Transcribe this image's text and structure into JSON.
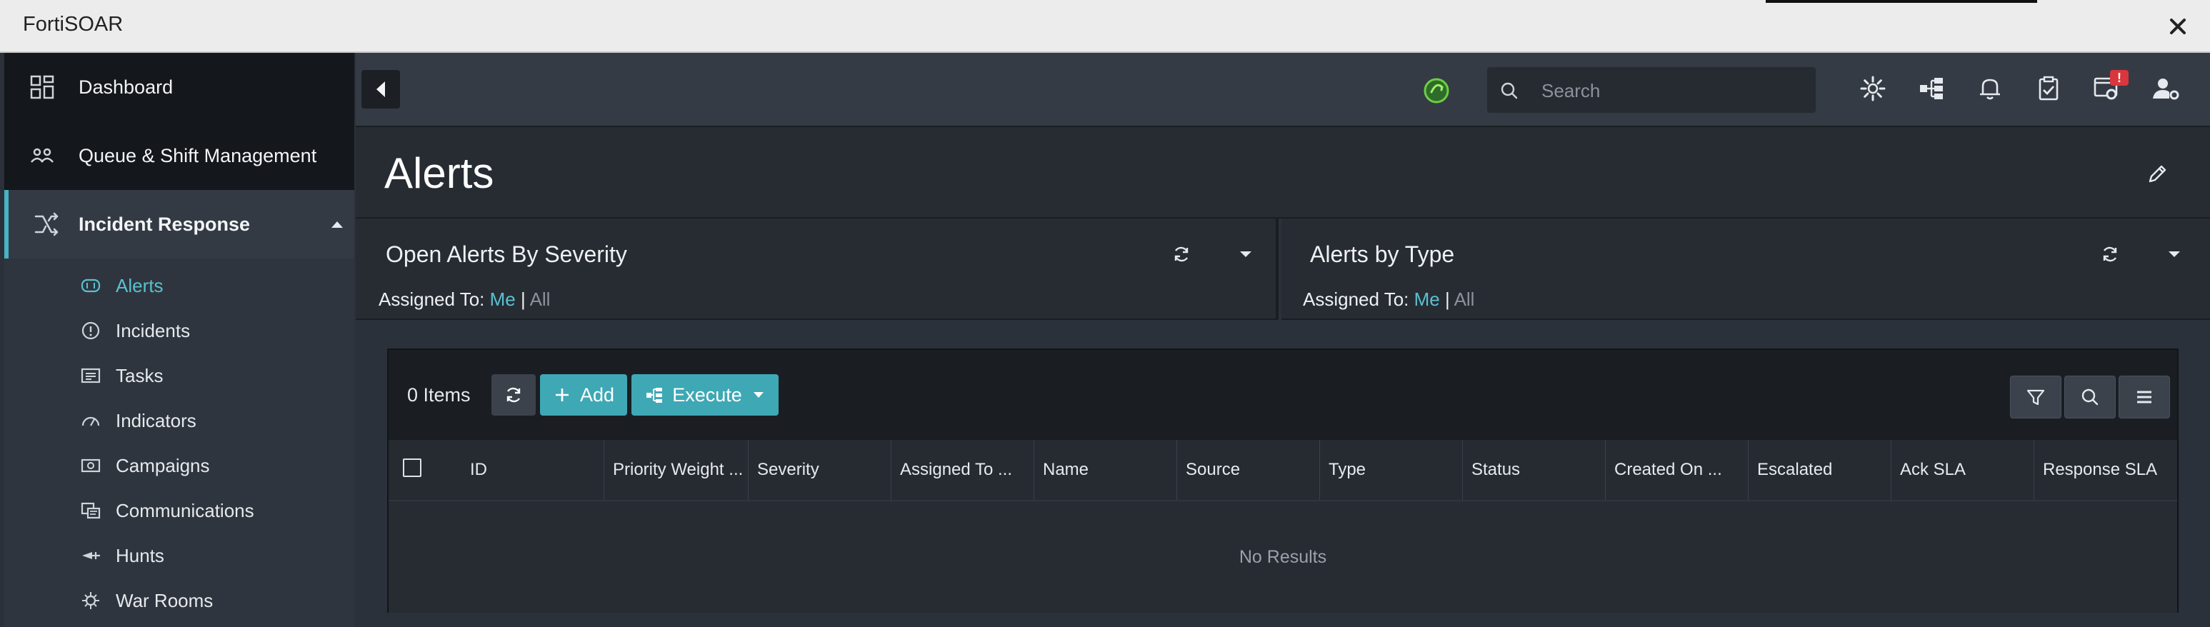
{
  "window": {
    "title": "FortiSOAR"
  },
  "sidebar": {
    "items": [
      {
        "label": "Dashboard",
        "icon": "dashboard-icon"
      },
      {
        "label": "Queue & Shift Management",
        "icon": "people-icon"
      },
      {
        "label": "Incident Response",
        "icon": "shuffle-icon",
        "expanded": true
      }
    ],
    "subitems": [
      {
        "label": "Alerts",
        "icon": "alerts-icon",
        "active": true
      },
      {
        "label": "Incidents",
        "icon": "info-circle-icon"
      },
      {
        "label": "Tasks",
        "icon": "tasks-icon"
      },
      {
        "label": "Indicators",
        "icon": "gauge-icon"
      },
      {
        "label": "Campaigns",
        "icon": "campaign-icon"
      },
      {
        "label": "Communications",
        "icon": "communications-icon"
      },
      {
        "label": "Hunts",
        "icon": "hunt-icon"
      },
      {
        "label": "War Rooms",
        "icon": "war-room-icon"
      }
    ]
  },
  "topbar": {
    "search_placeholder": "Search",
    "notification_badge": "!"
  },
  "page": {
    "title": "Alerts"
  },
  "widgets": [
    {
      "title": "Open Alerts By Severity",
      "assigned_label": "Assigned To:",
      "me": "Me",
      "sep": "|",
      "all": "All"
    },
    {
      "title": "Alerts by Type",
      "assigned_label": "Assigned To:",
      "me": "Me",
      "sep": "|",
      "all": "All"
    }
  ],
  "grid": {
    "items_count": "0 Items",
    "add_label": "Add",
    "execute_label": "Execute",
    "columns": [
      "ID",
      "Priority Weight ...",
      "Severity",
      "Assigned To ...",
      "Name",
      "Source",
      "Type",
      "Status",
      "Created On ...",
      "Escalated",
      "Ack SLA",
      "Response SLA"
    ],
    "empty_text": "No Results"
  },
  "colors": {
    "accent": "#3ea8b5",
    "link": "#59c1d1",
    "sidebar_dark": "#14171b",
    "badge": "#d9363e"
  }
}
